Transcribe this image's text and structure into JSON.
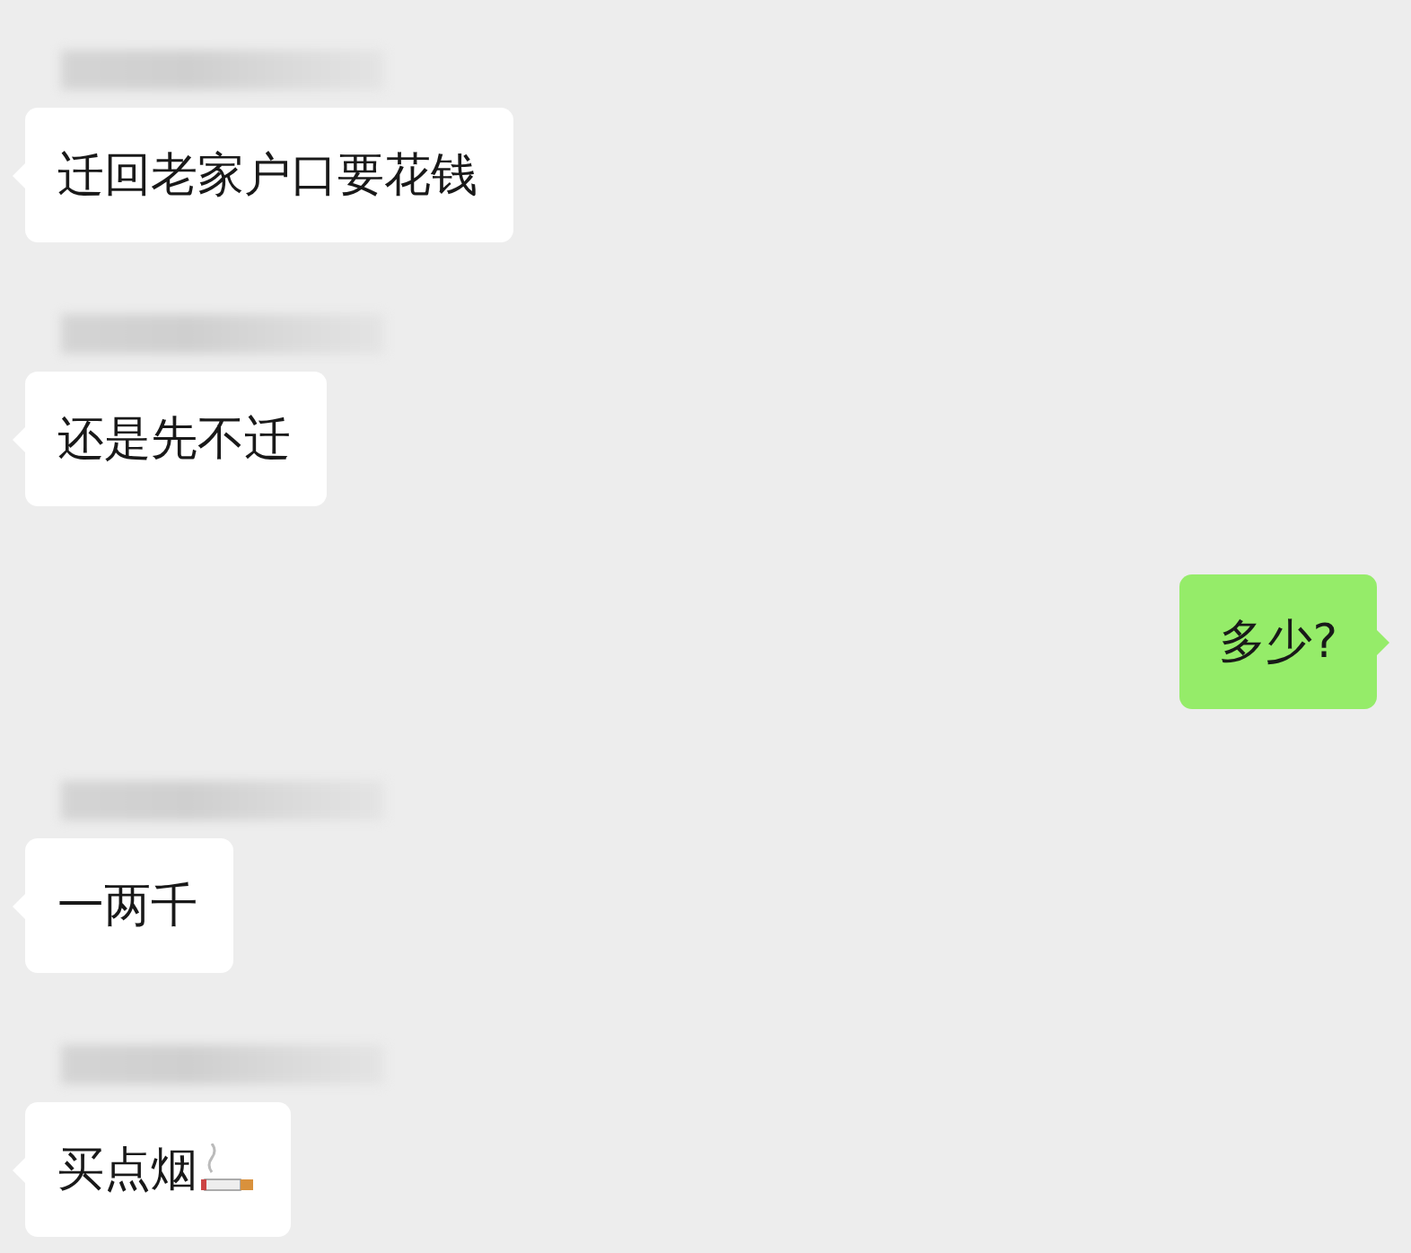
{
  "messages": [
    {
      "kind": "received",
      "name_blurred": true,
      "text": "迁回老家户口要花钱",
      "trailing_emoji": false
    },
    {
      "kind": "received",
      "name_blurred": true,
      "text": "还是先不迁",
      "trailing_emoji": false
    },
    {
      "kind": "sent",
      "name_blurred": false,
      "text": "多少?",
      "trailing_emoji": false
    },
    {
      "kind": "received",
      "name_blurred": true,
      "text": "一两千",
      "trailing_emoji": false
    },
    {
      "kind": "received",
      "name_blurred": true,
      "text": "买点烟",
      "trailing_emoji": true
    }
  ]
}
